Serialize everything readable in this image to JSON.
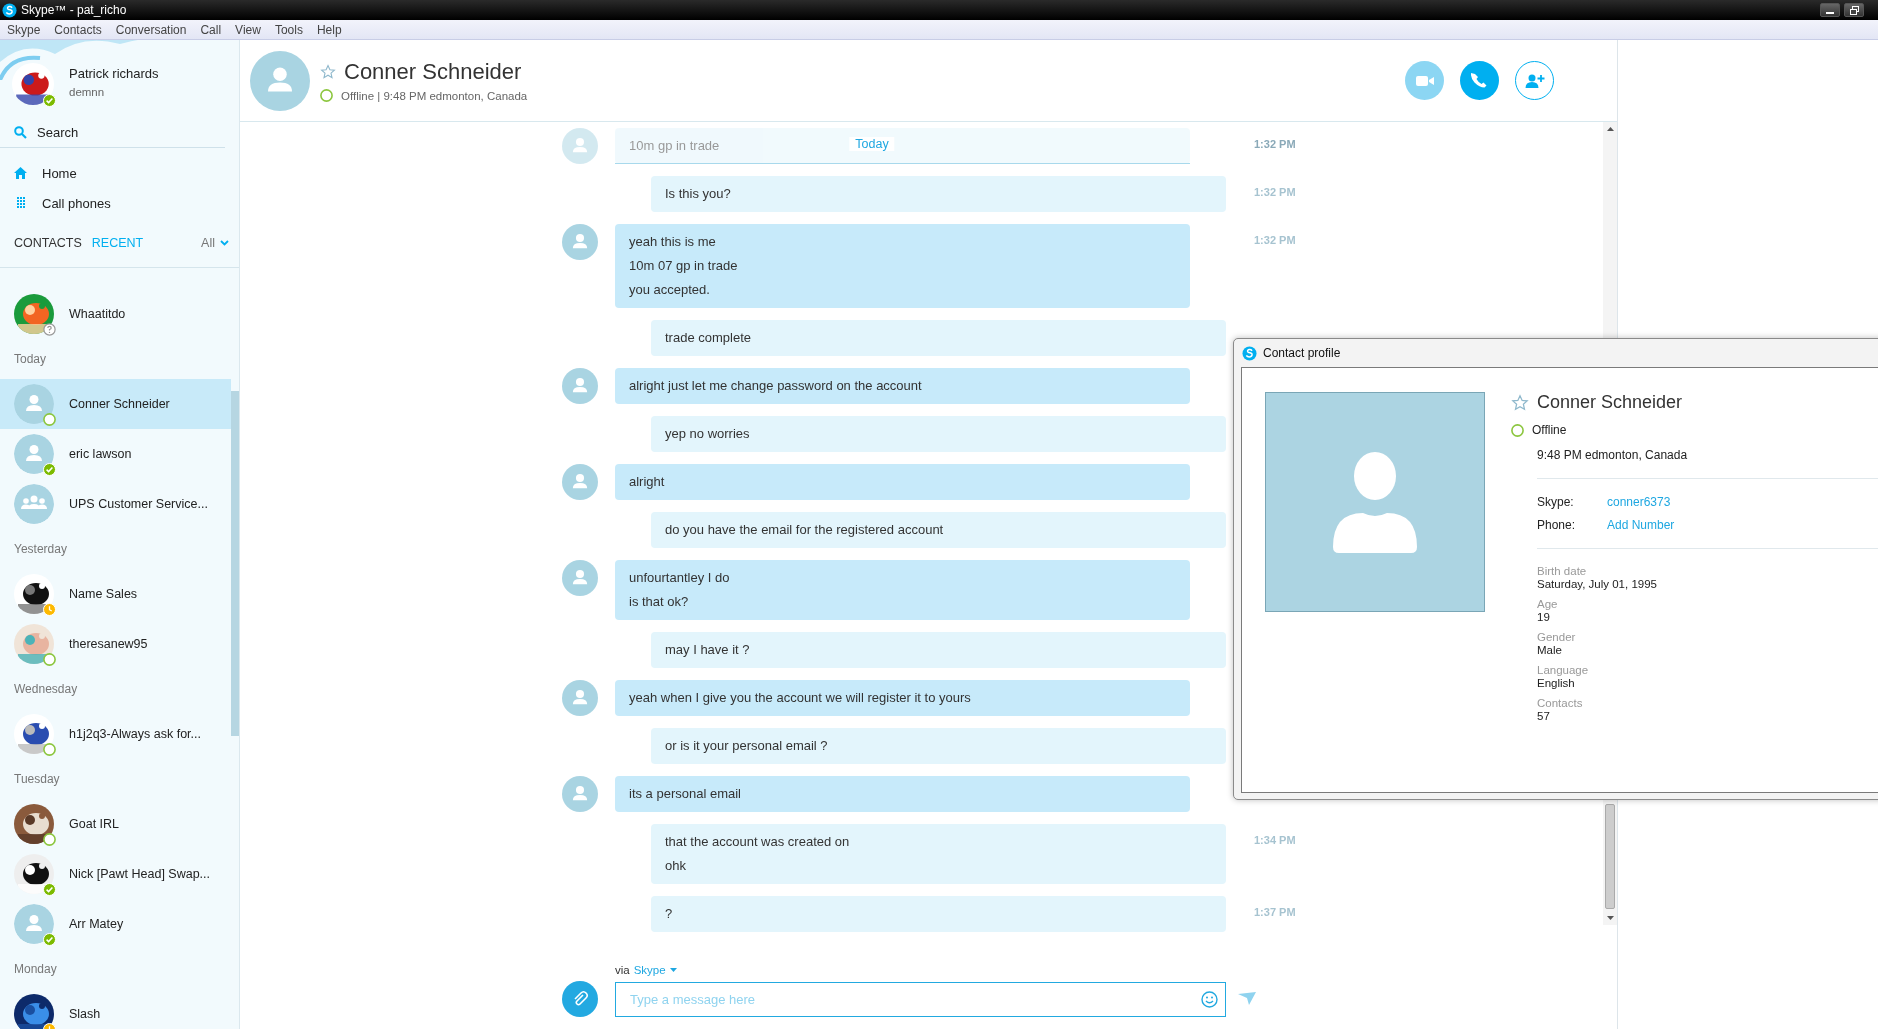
{
  "window": {
    "title": "Skype™ - pat_richo"
  },
  "menu": [
    "Skype",
    "Contacts",
    "Conversation",
    "Call",
    "View",
    "Tools",
    "Help"
  ],
  "profile": {
    "name": "Patrick richards",
    "mood": "demnn",
    "status": {
      "kind": "online"
    }
  },
  "search": {
    "label": "Search"
  },
  "nav": [
    {
      "kind": "home",
      "label": "Home"
    },
    {
      "kind": "dialpad",
      "label": "Call phones"
    }
  ],
  "list_tabs": [
    {
      "label": "CONTACTS",
      "selected": false
    },
    {
      "label": "RECENT",
      "selected": true
    }
  ],
  "filter": {
    "label": "All"
  },
  "recent": [
    {
      "kind": "contact",
      "name": "Whaatitdo",
      "status": {
        "kind": "unknown"
      },
      "selected": false
    },
    {
      "kind": "header",
      "label": "Today"
    },
    {
      "kind": "contact",
      "name": "Conner Schneider",
      "avatar": {
        "kind": "default"
      },
      "status": {
        "kind": "offline"
      },
      "selected": true
    },
    {
      "kind": "contact",
      "name": "eric lawson",
      "avatar": {
        "kind": "default"
      },
      "status": {
        "kind": "online"
      },
      "selected": false
    },
    {
      "kind": "contact",
      "name": "UPS Customer Service...",
      "avatar": {
        "kind": "group"
      },
      "selected": false
    },
    {
      "kind": "header",
      "label": "Yesterday"
    },
    {
      "kind": "contact",
      "name": "Name Sales",
      "status": {
        "kind": "away"
      },
      "selected": false
    },
    {
      "kind": "contact",
      "name": "theresanew95",
      "status": {
        "kind": "offline"
      },
      "selected": false
    },
    {
      "kind": "header",
      "label": "Wednesday"
    },
    {
      "kind": "contact",
      "name": "h1j2q3-Always ask for...",
      "status": {
        "kind": "offline"
      },
      "selected": false
    },
    {
      "kind": "header",
      "label": "Tuesday"
    },
    {
      "kind": "contact",
      "name": "Goat IRL",
      "status": {
        "kind": "offline"
      },
      "selected": false
    },
    {
      "kind": "contact",
      "name": "Nick [Pawt Head] Swap...",
      "status": {
        "kind": "online"
      },
      "selected": false
    },
    {
      "kind": "contact",
      "name": "Arr Matey",
      "avatar": {
        "kind": "default"
      },
      "status": {
        "kind": "online"
      },
      "selected": false
    },
    {
      "kind": "header",
      "label": "Monday"
    },
    {
      "kind": "contact",
      "name": "Slash",
      "status": {
        "kind": "away"
      },
      "selected": false
    }
  ],
  "conversation": {
    "name": "Conner Schneider",
    "favorite": false,
    "status": {
      "kind": "offline"
    },
    "details": "Offline | 9:48 PM edmonton, Canada",
    "buttons": [
      {
        "kind": "video",
        "disabled": true
      },
      {
        "kind": "call",
        "disabled": false
      },
      {
        "kind": "add-contact",
        "disabled": false
      }
    ]
  },
  "day_divider": "Today",
  "messages": [
    {
      "kind": "ghost",
      "lines": [
        "10m gp in trade"
      ],
      "time": "1:32 PM"
    },
    {
      "kind": "outgoing",
      "lines": [
        "Is this you?"
      ],
      "time": "1:32 PM"
    },
    {
      "kind": "incoming",
      "lines": [
        "yeah this is me",
        "10m 07 gp in trade",
        "you accepted."
      ],
      "time": "1:32 PM"
    },
    {
      "kind": "outgoing",
      "lines": [
        "trade complete"
      ]
    },
    {
      "kind": "incoming",
      "lines": [
        "alright just let me change password on the account"
      ]
    },
    {
      "kind": "outgoing",
      "lines": [
        "yep no worries"
      ]
    },
    {
      "kind": "incoming",
      "lines": [
        "alright"
      ]
    },
    {
      "kind": "outgoing",
      "lines": [
        "do you have the email for the registered account"
      ]
    },
    {
      "kind": "incoming",
      "lines": [
        "unfourtantley I do",
        "is that ok?"
      ]
    },
    {
      "kind": "outgoing",
      "lines": [
        "may I have it ?"
      ]
    },
    {
      "kind": "incoming",
      "lines": [
        "yeah when I give you the account we will register it to yours"
      ]
    },
    {
      "kind": "outgoing",
      "lines": [
        "or is it your personal email ?"
      ]
    },
    {
      "kind": "incoming",
      "lines": [
        "its a personal email"
      ]
    },
    {
      "kind": "outgoing",
      "lines": [
        "that the account was created on",
        "ohk"
      ],
      "time": "1:34 PM"
    },
    {
      "kind": "outgoing",
      "lines": [
        "?"
      ],
      "time": "1:37 PM"
    }
  ],
  "composer": {
    "via": "via",
    "service": "Skype",
    "placeholder": "Type a message here"
  },
  "contact_profile": {
    "title": "Contact profile",
    "name": "Conner Schneider",
    "favorite": false,
    "status": {
      "kind": "offline"
    },
    "presence": "Offline",
    "local_time": "9:48 PM edmonton, Canada",
    "accounts": [
      {
        "label": "Skype:",
        "value": "conner6373"
      },
      {
        "label": "Phone:",
        "value": "Add Number"
      }
    ],
    "facts": [
      {
        "label": "Birth date",
        "value": "Saturday, July 01, 1995"
      },
      {
        "label": "Age",
        "value": "19"
      },
      {
        "label": "Gender",
        "value": "Male"
      },
      {
        "label": "Language",
        "value": "English"
      },
      {
        "label": "Contacts",
        "value": "57"
      }
    ]
  }
}
